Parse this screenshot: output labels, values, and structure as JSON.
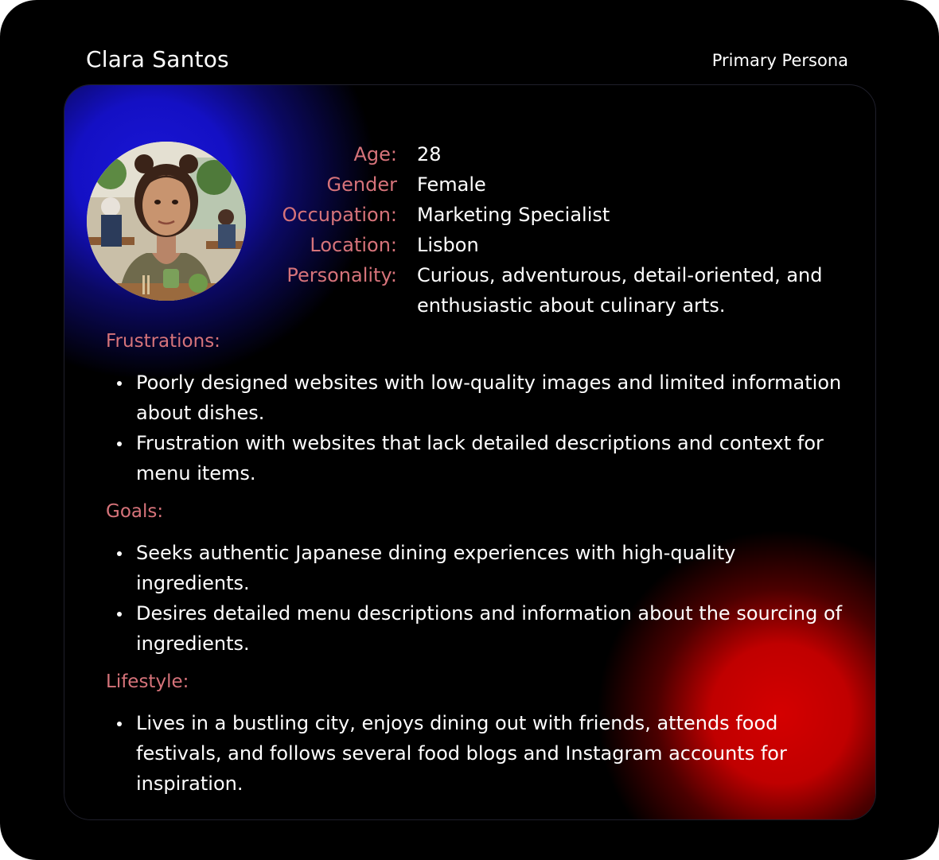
{
  "header": {
    "name": "Clara Santos",
    "persona_type": "Primary Persona"
  },
  "profile": {
    "avatar_icon": "woman-portrait-photo",
    "fields": [
      {
        "label": "Age:",
        "value": "28"
      },
      {
        "label": "Gender",
        "value": "Female"
      },
      {
        "label": "Occupation:",
        "value": "Marketing Specialist"
      },
      {
        "label": "Location:",
        "value": "Lisbon"
      },
      {
        "label": "Personality:",
        "value": "Curious, adventurous, detail-oriented, and enthusiastic about culinary arts."
      }
    ]
  },
  "sections": {
    "frustrations": {
      "title": "Frustrations:",
      "items": [
        "Poorly designed websites with low-quality images and limited information about dishes.",
        "Frustration with websites that lack detailed descriptions and context for menu items."
      ]
    },
    "goals": {
      "title": "Goals:",
      "items": [
        "Seeks authentic Japanese dining experiences with high-quality ingredients.",
        "Desires detailed menu descriptions and information about the sourcing of ingredients."
      ]
    },
    "lifestyle": {
      "title": "Lifestyle:",
      "items": [
        "Lives in a bustling city, enjoys dining out with friends, attends food festivals, and follows several food blogs and Instagram accounts for inspiration."
      ]
    }
  },
  "colors": {
    "background": "#000000",
    "label": "#d6737a",
    "text": "#ffffff",
    "glow_blue": "#1a16d6",
    "glow_red": "#d40000"
  }
}
